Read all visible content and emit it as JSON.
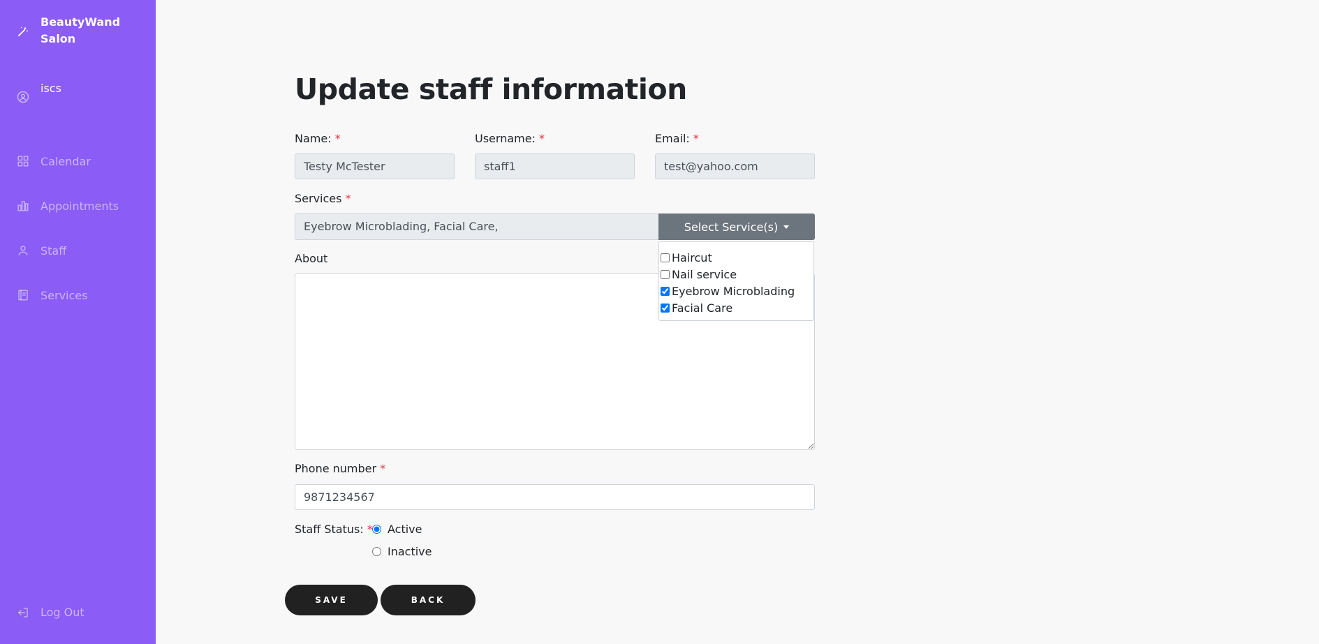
{
  "sidebar": {
    "brand": "BeautyWand Salon",
    "user": "iscs",
    "items": [
      {
        "label": "Calendar",
        "icon": "grid-icon"
      },
      {
        "label": "Appointments",
        "icon": "bar-chart-icon"
      },
      {
        "label": "Staff",
        "icon": "user-icon"
      },
      {
        "label": "Services",
        "icon": "book-icon"
      }
    ],
    "logout": "Log Out",
    "bg_color": "#8b5cf6"
  },
  "form": {
    "title": "Update staff information",
    "name_label": "Name:",
    "name_value": "Testy McTester",
    "username_label": "Username:",
    "username_value": "staff1",
    "email_label": "Email:",
    "email_value": "test@yahoo.com",
    "services_label": "Services",
    "services_value": "Eyebrow Microblading, Facial Care,",
    "services_button": "Select Service(s)",
    "services_options": [
      {
        "label": "Haircut",
        "checked": false
      },
      {
        "label": "Nail service",
        "checked": false
      },
      {
        "label": "Eyebrow Microblading",
        "checked": true
      },
      {
        "label": "Facial Care",
        "checked": true
      }
    ],
    "about_label": "About",
    "about_value": "",
    "phone_label": "Phone number",
    "phone_value": "9871234567",
    "status_label": "Staff Status:",
    "status_options": [
      "Active",
      "Inactive"
    ],
    "status_selected": "Active",
    "required_marker": "*",
    "save_label": "SAVE",
    "back_label": "BACK"
  }
}
